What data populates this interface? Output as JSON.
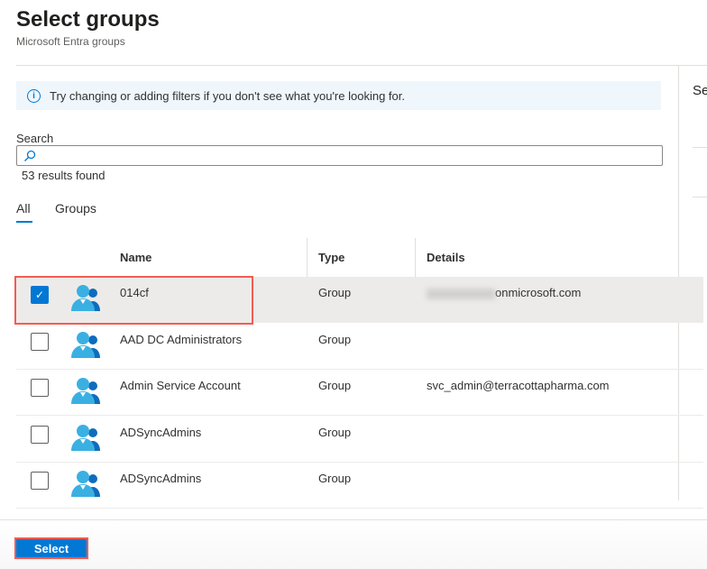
{
  "header": {
    "title": "Select groups",
    "subtitle": "Microsoft Entra groups"
  },
  "info": {
    "icon": "info-icon",
    "text": "Try changing or adding filters if you don't see what you're looking for."
  },
  "search": {
    "label": "Search",
    "placeholder": "",
    "results": "53 results found"
  },
  "tabs": [
    {
      "label": "All",
      "active": true
    },
    {
      "label": "Groups",
      "active": false
    }
  ],
  "table": {
    "columns": [
      "Name",
      "Type",
      "Details"
    ],
    "rows": [
      {
        "name": "014cf",
        "type": "Group",
        "details": "onmicrosoft.com",
        "details_blurred": true,
        "checked": true
      },
      {
        "name": "AAD DC Administrators",
        "type": "Group",
        "details": "",
        "checked": false
      },
      {
        "name": "Admin Service Account",
        "type": "Group",
        "details": "svc_admin@terracottapharma.com",
        "checked": false
      },
      {
        "name": "ADSyncAdmins",
        "type": "Group",
        "details": "",
        "checked": false
      },
      {
        "name": "ADSyncAdmins",
        "type": "Group",
        "details": "",
        "checked": false
      }
    ]
  },
  "side_panel": {
    "title_partial": "Se"
  },
  "footer": {
    "select_label": "Select"
  },
  "colors": {
    "accent": "#0078d4",
    "highlight": "#f25c54",
    "selected_row": "#edebe9"
  }
}
